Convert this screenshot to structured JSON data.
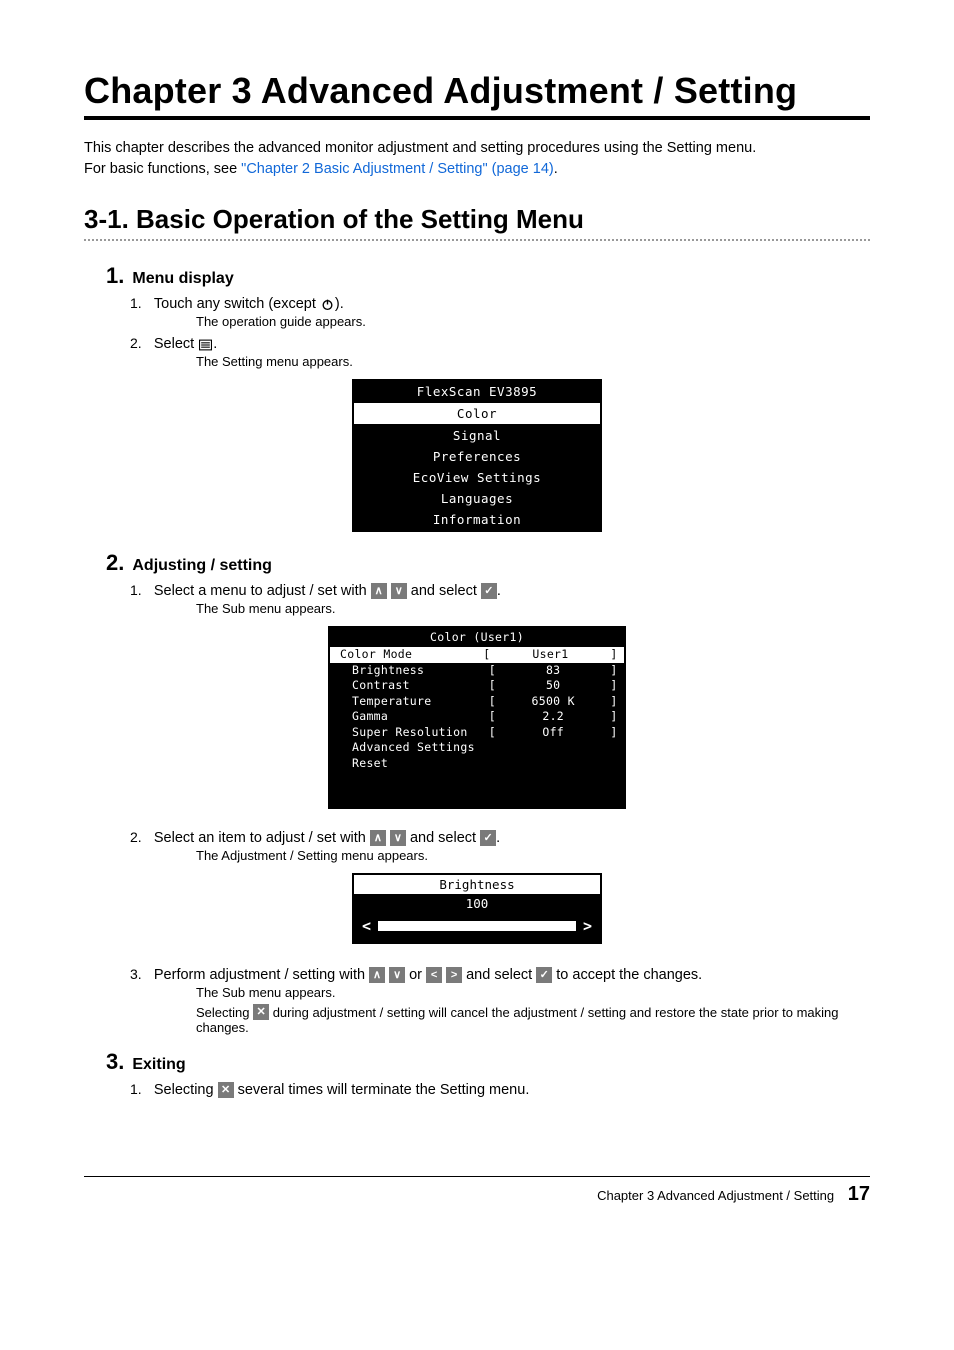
{
  "chapter_title": "Chapter 3   Advanced Adjustment / Setting",
  "intro_text_1": "This chapter describes the advanced monitor adjustment and setting procedures using the Setting menu.",
  "intro_text_2a": "For basic functions, see ",
  "intro_link": "\"Chapter 2 Basic Adjustment / Setting\" (page 14)",
  "intro_text_2b": ".",
  "section_title": "3-1.  Basic Operation of the Setting Menu",
  "steps": {
    "s1": {
      "num": "1.",
      "label": "Menu display",
      "items": {
        "i1": {
          "num": "1.",
          "text_a": "Touch any switch (except ",
          "text_b": ")."
        },
        "i1_sub": "The operation guide appears.",
        "i2": {
          "num": "2.",
          "text_a": "Select ",
          "text_b": "."
        },
        "i2_sub": "The Setting menu appears."
      }
    },
    "s2": {
      "num": "2.",
      "label": "Adjusting / setting",
      "items": {
        "i1": {
          "num": "1.",
          "text_a": "Select a menu to adjust / set with ",
          "text_b": " and select ",
          "text_c": "."
        },
        "i1_sub": "The Sub menu appears.",
        "i2": {
          "num": "2.",
          "text_a": "Select an item to adjust / set with ",
          "text_b": " and select ",
          "text_c": "."
        },
        "i2_sub": "The Adjustment / Setting menu appears.",
        "i3": {
          "num": "3.",
          "text_a": "Perform adjustment / setting with ",
          "text_b": " or ",
          "text_c": " and select ",
          "text_d": " to accept the changes."
        },
        "i3_sub": "The Sub menu appears.",
        "i3_sub2a": "Selecting ",
        "i3_sub2b": " during adjustment / setting will cancel the adjustment / setting and restore the state prior to making changes."
      }
    },
    "s3": {
      "num": "3.",
      "label": "Exiting",
      "items": {
        "i1": {
          "num": "1.",
          "text_a": "Selecting ",
          "text_b": " several times will terminate the Setting menu."
        }
      }
    }
  },
  "osd1": {
    "title": "FlexScan EV3895",
    "rows": [
      "Color",
      "Signal",
      "Preferences",
      "EcoView Settings",
      "Languages",
      "Information"
    ],
    "selected_index": 0
  },
  "osd2": {
    "title": "Color (User1)",
    "rows": [
      {
        "label": "Color Mode",
        "value": "User1",
        "indent": false,
        "selected": true
      },
      {
        "label": "Brightness",
        "value": "83",
        "indent": true,
        "selected": false
      },
      {
        "label": "Contrast",
        "value": "50",
        "indent": true,
        "selected": false
      },
      {
        "label": "Temperature",
        "value": "6500 K",
        "indent": true,
        "selected": false
      },
      {
        "label": "Gamma",
        "value": "2.2",
        "indent": true,
        "selected": false
      },
      {
        "label": "Super Resolution",
        "value": "Off",
        "indent": true,
        "selected": false
      },
      {
        "label": "Advanced Settings",
        "value": "",
        "indent": true,
        "selected": false
      },
      {
        "label": "Reset",
        "value": "",
        "indent": true,
        "selected": false
      }
    ]
  },
  "osd3": {
    "title": "Brightness",
    "value": "100",
    "left": "<",
    "right": ">"
  },
  "icons": {
    "up": "∧",
    "down": "∨",
    "left": "<",
    "right": ">",
    "check": "✓",
    "close": "✕"
  },
  "footer": {
    "label": "Chapter 3 Advanced Adjustment / Setting",
    "page": "17"
  }
}
